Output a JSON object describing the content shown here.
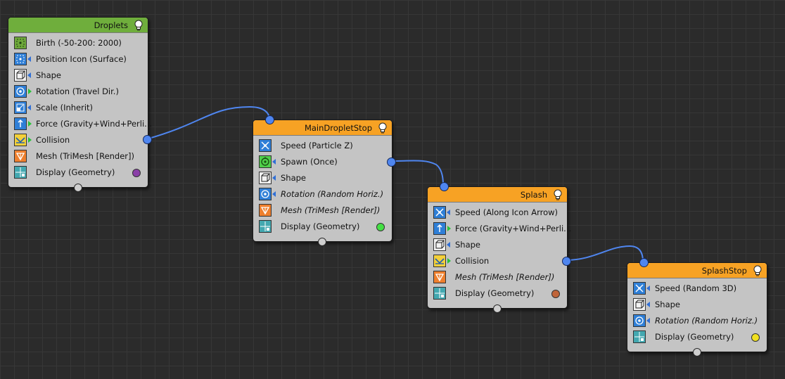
{
  "nodes": {
    "droplets": {
      "title": "Droplets",
      "header_color": "#6fae3c",
      "rows": [
        {
          "label": "Birth (-50-200: 2000)",
          "icon": "birth-icon"
        },
        {
          "label": "Position Icon (Surface)",
          "icon": "position-icon"
        },
        {
          "label": "Shape",
          "icon": "shape-icon"
        },
        {
          "label": "Rotation (Travel Dir.)",
          "icon": "rotation-icon"
        },
        {
          "label": "Scale (Inherit)",
          "icon": "scale-icon"
        },
        {
          "label": "Force (Gravity+Wind+Perli...",
          "icon": "force-icon"
        },
        {
          "label": "Collision",
          "icon": "collision-icon"
        },
        {
          "label": "Mesh (TriMesh [Render])",
          "icon": "mesh-icon"
        },
        {
          "label": "Display (Geometry)",
          "icon": "display-icon",
          "dot_color": "#8a3fa8"
        }
      ]
    },
    "main_droplet_stop": {
      "title": "MainDropletStop",
      "header_color": "#f7a224",
      "rows": [
        {
          "label": "Speed (Particle Z)",
          "icon": "speed-icon"
        },
        {
          "label": "Spawn (Once)",
          "icon": "spawn-icon"
        },
        {
          "label": "Shape",
          "icon": "shape-icon"
        },
        {
          "label": "Rotation (Random Horiz.)",
          "icon": "rotation-icon",
          "italic": true
        },
        {
          "label": "Mesh (TriMesh [Render])",
          "icon": "mesh-icon",
          "italic": true
        },
        {
          "label": "Display (Geometry)",
          "icon": "display-icon",
          "dot_color": "#44e044"
        }
      ]
    },
    "splash": {
      "title": "Splash",
      "header_color": "#f7a224",
      "rows": [
        {
          "label": "Speed (Along Icon Arrow)",
          "icon": "speed-icon"
        },
        {
          "label": "Force (Gravity+Wind+Perli...",
          "icon": "force-icon"
        },
        {
          "label": "Shape",
          "icon": "shape-icon"
        },
        {
          "label": "Collision",
          "icon": "collision-icon"
        },
        {
          "label": "Mesh (TriMesh [Render])",
          "icon": "mesh-icon",
          "italic": true
        },
        {
          "label": "Display (Geometry)",
          "icon": "display-icon",
          "dot_color": "#c0653a"
        }
      ]
    },
    "splash_stop": {
      "title": "SplashStop",
      "header_color": "#f7a224",
      "rows": [
        {
          "label": "Speed (Random 3D)",
          "icon": "speed-icon"
        },
        {
          "label": "Shape",
          "icon": "shape-icon"
        },
        {
          "label": "Rotation (Random Horiz.)",
          "icon": "rotation-icon",
          "italic": true
        },
        {
          "label": "Display (Geometry)",
          "icon": "display-icon",
          "dot_color": "#f0e020"
        }
      ]
    }
  },
  "colors": {
    "wire": "#4f86f0",
    "background": "#2b2b2b",
    "node_body": "#c4c4c4"
  }
}
